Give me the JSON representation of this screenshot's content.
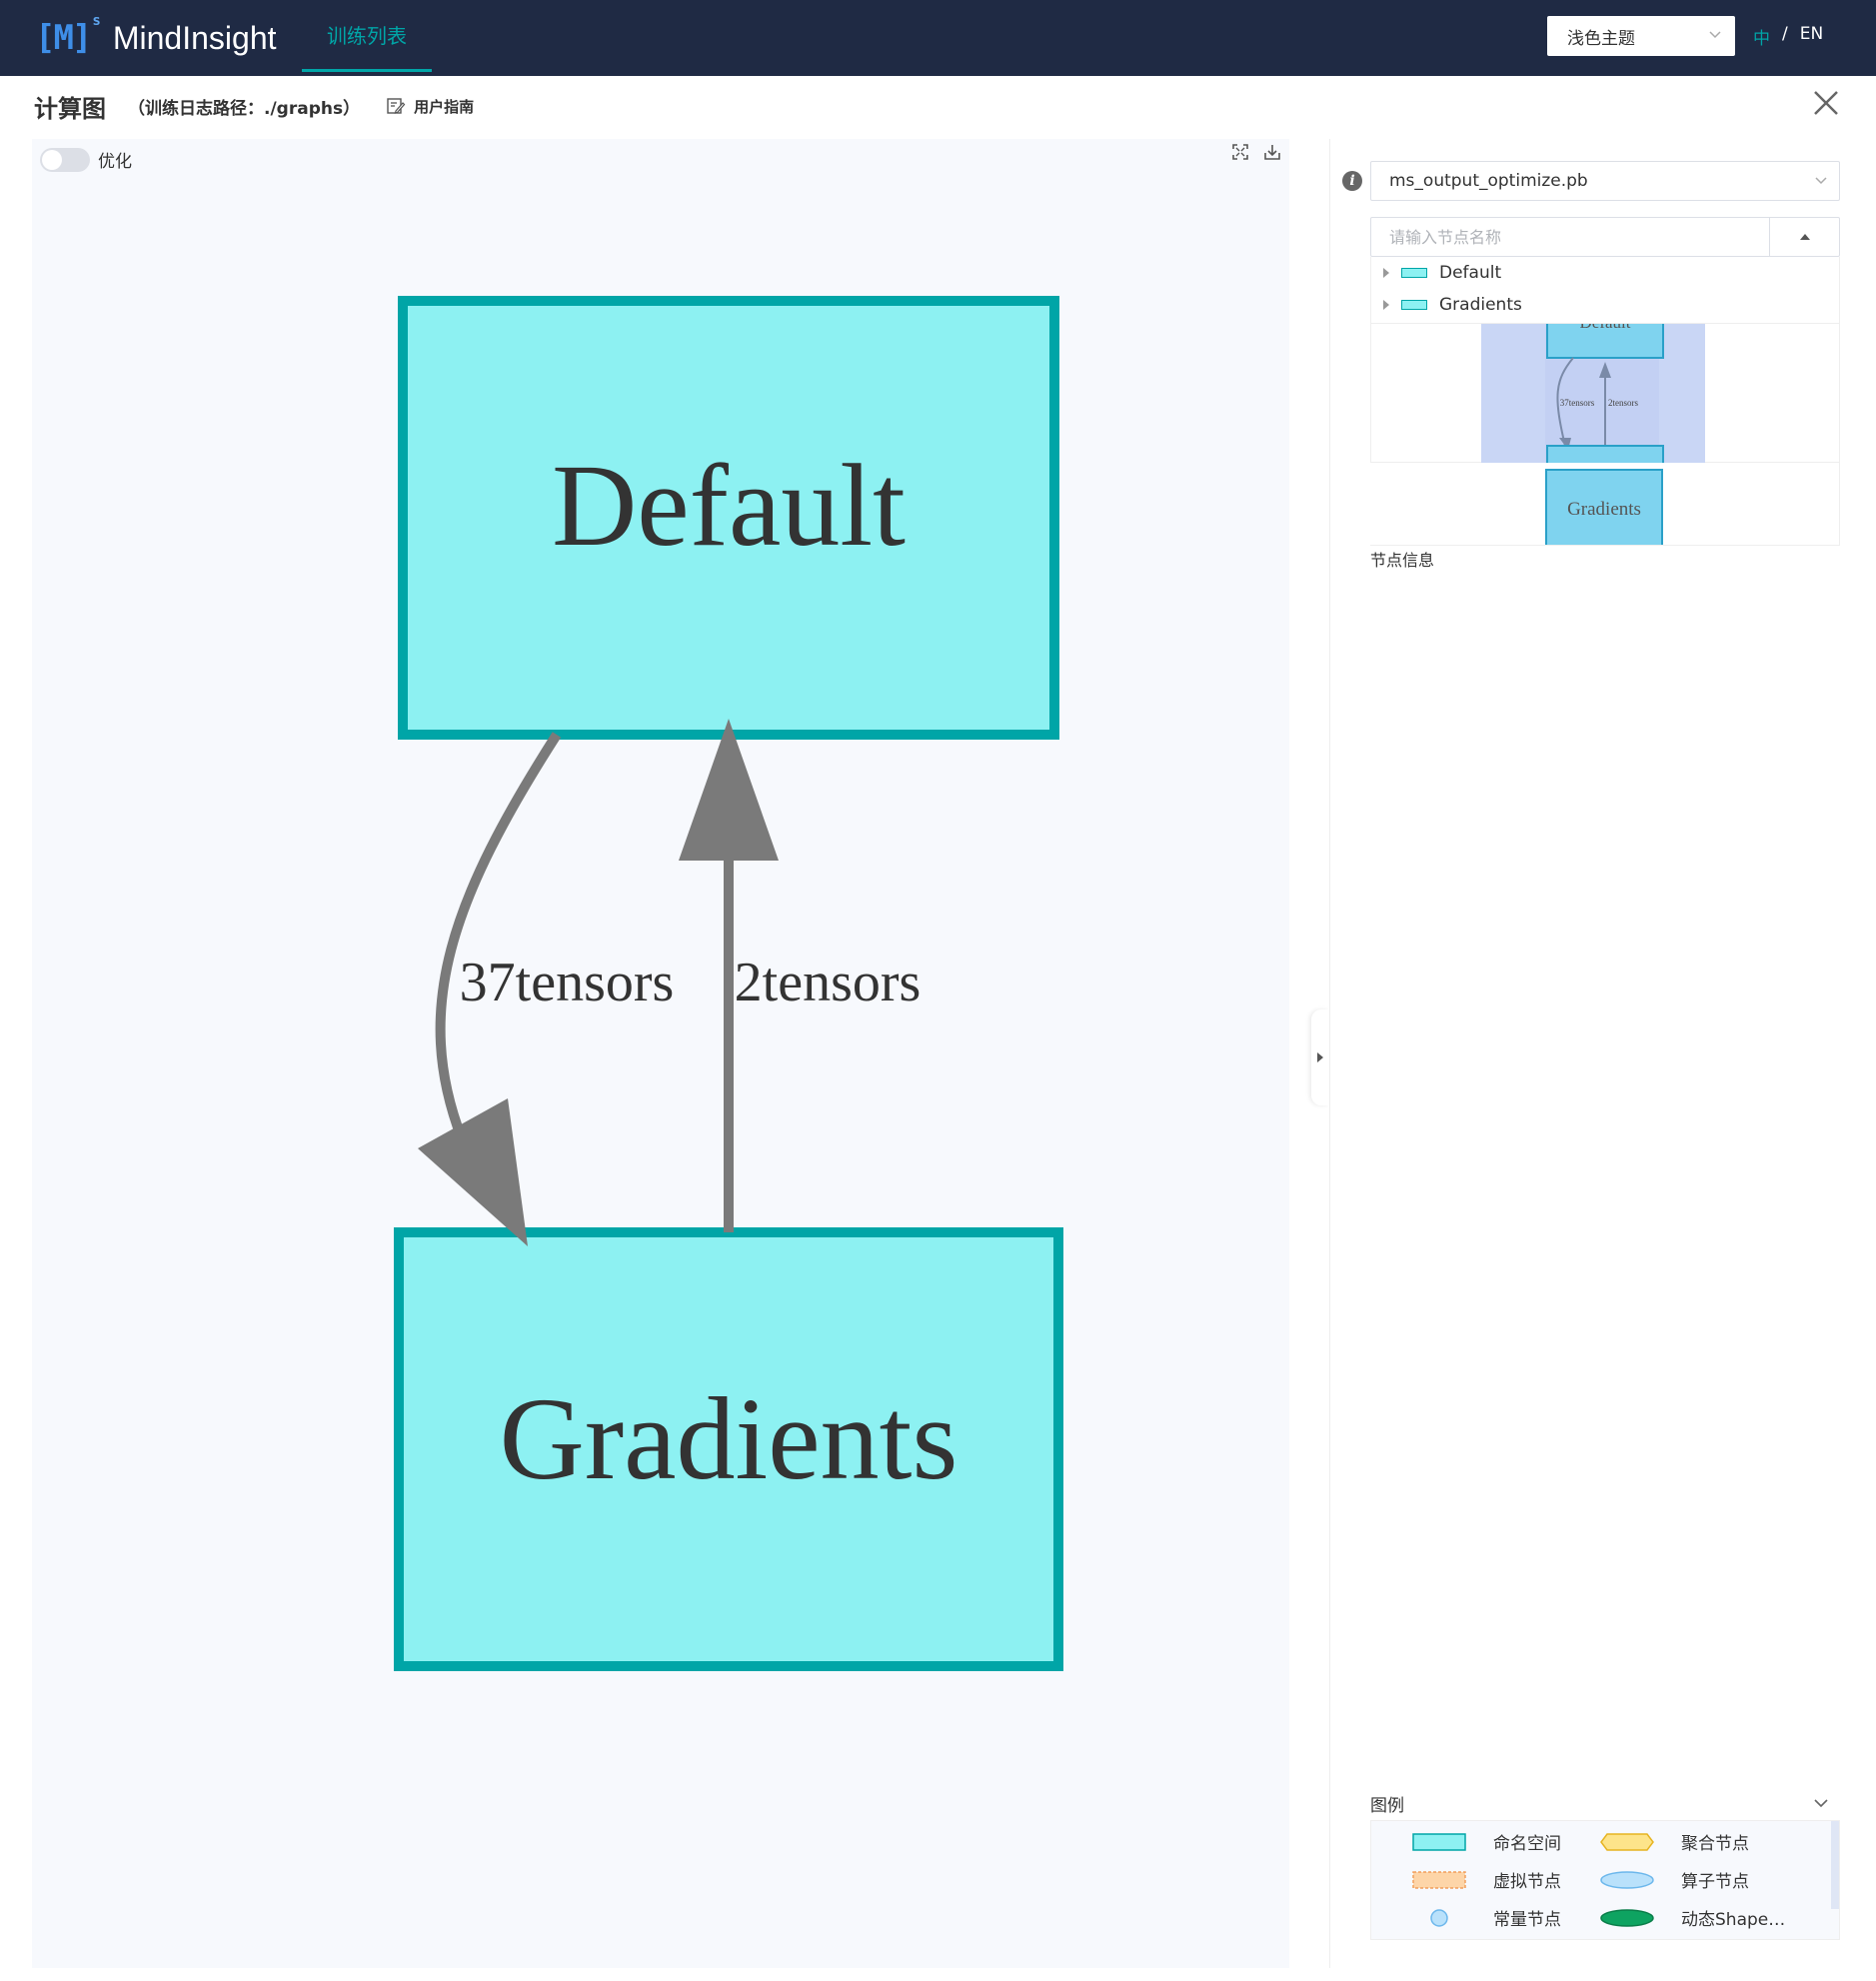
{
  "nav": {
    "brand_mark": "[M]",
    "brand_sup": "s",
    "brand_name": "MindInsight",
    "tab_label": "训练列表",
    "theme_value": "浅色主题",
    "lang_zh": "中",
    "lang_sep": "/",
    "lang_en": "EN"
  },
  "header": {
    "title": "计算图",
    "log_path": "（训练日志路径：./graphs）",
    "guide_label": "用户指南"
  },
  "canvas": {
    "optimize_label": "优化",
    "optimize_on": false,
    "nodes": {
      "top": "Default",
      "bottom": "Gradients"
    },
    "edges": {
      "down": "37tensors",
      "up": "2tensors"
    }
  },
  "panel": {
    "file_value": "ms_output_optimize.pb",
    "search_placeholder": "请输入节点名称",
    "tree_items": [
      "Default",
      "Gradients"
    ],
    "minimap": {
      "top_node": "Default",
      "bottom_node": "Gradients",
      "edge_down": "37tensors",
      "edge_up": "2tensors"
    },
    "node_info_label": "节点信息",
    "legend_title": "图例",
    "legend": [
      {
        "label": "命名空间",
        "shape": "rect",
        "fill": "#8df1f2",
        "stroke": "#00a5a7"
      },
      {
        "label": "聚合节点",
        "shape": "hexagon",
        "fill": "#fde48a",
        "stroke": "#e6b422"
      },
      {
        "label": "虚拟节点",
        "shape": "rect-dashed",
        "fill": "#fdd5a8",
        "stroke": "#f29f5c"
      },
      {
        "label": "算子节点",
        "shape": "ellipse",
        "fill": "#b9e1fb",
        "stroke": "#6cb7ec"
      },
      {
        "label": "常量节点",
        "shape": "circle",
        "fill": "#b9e1fb",
        "stroke": "#6cb7ec"
      },
      {
        "label": "动态Shape…",
        "shape": "ellipse-dark",
        "fill": "#0ea361",
        "stroke": "#0a7d49"
      }
    ]
  },
  "colors": {
    "navbar": "#1f2a44",
    "accent": "#00a5a7",
    "namespace_fill": "#8df1f2",
    "edge": "#7a7a7a"
  }
}
